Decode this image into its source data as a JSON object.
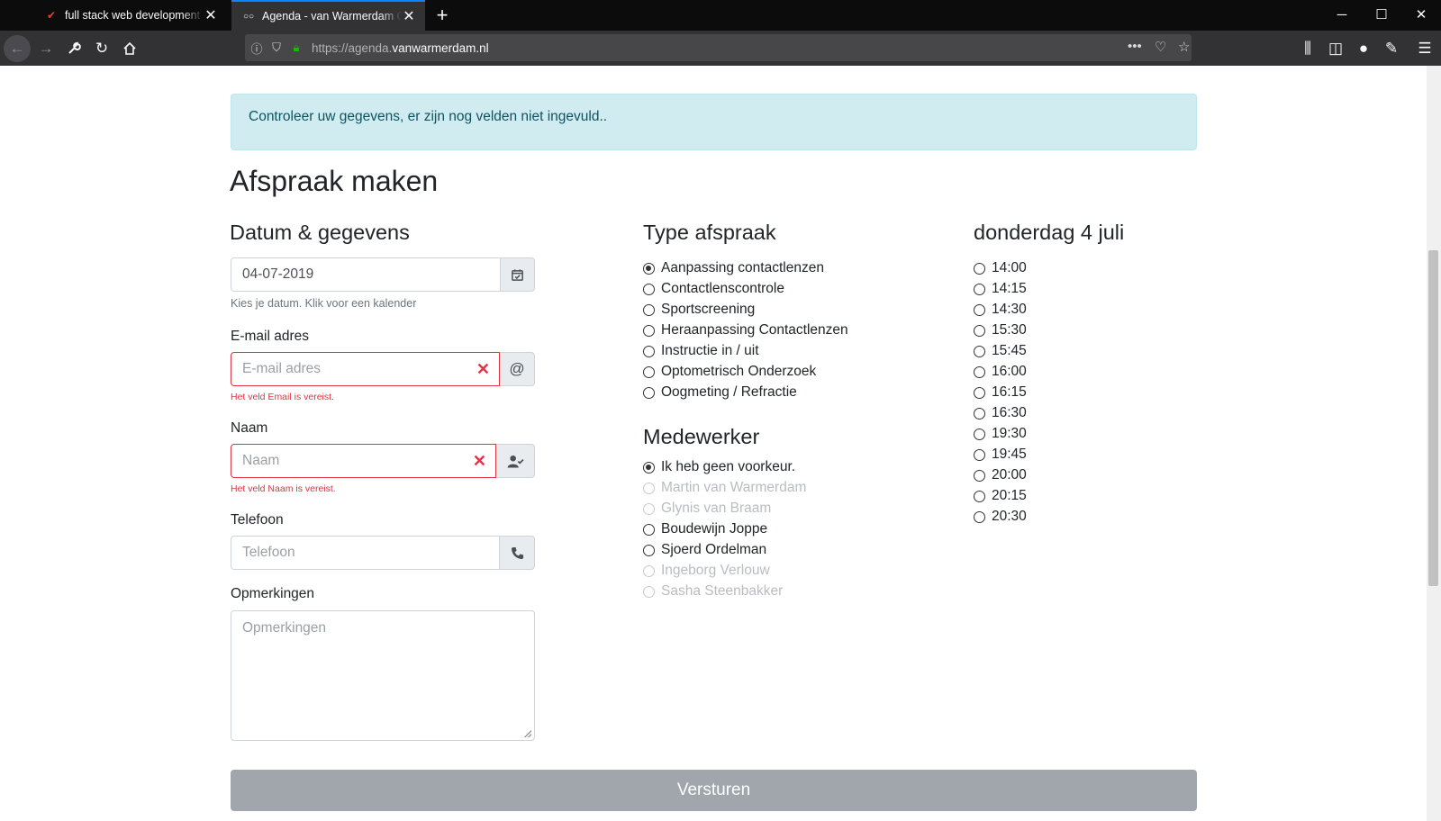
{
  "browser": {
    "tabs": [
      {
        "title": "full stack web development .ne",
        "icon": "brand-bird-icon"
      },
      {
        "title": "Agenda - van Warmerdam Opt",
        "icon": "glasses-icon"
      }
    ],
    "url_prefix": "https://agenda.",
    "url_domain": "vanwarmerdam.nl"
  },
  "alert": {
    "text": "Controleer uw gegevens, er zijn nog velden niet ingevuld.."
  },
  "page": {
    "title": "Afspraak maken"
  },
  "left": {
    "heading": "Datum & gegevens",
    "date": {
      "value": "04-07-2019",
      "help": "Kies je datum. Klik voor een kalender"
    },
    "email": {
      "label": "E-mail adres",
      "placeholder": "E-mail adres",
      "error": "Het veld Email is vereist."
    },
    "name": {
      "label": "Naam",
      "placeholder": "Naam",
      "error": "Het veld Naam is vereist."
    },
    "phone": {
      "label": "Telefoon",
      "placeholder": "Telefoon"
    },
    "remarks": {
      "label": "Opmerkingen",
      "placeholder": "Opmerkingen"
    }
  },
  "type": {
    "heading": "Type afspraak",
    "options": [
      {
        "label": "Aanpassing contactlenzen",
        "checked": true
      },
      {
        "label": "Contactlenscontrole",
        "checked": false
      },
      {
        "label": "Sportscreening",
        "checked": false
      },
      {
        "label": "Heraanpassing Contactlenzen",
        "checked": false
      },
      {
        "label": "Instructie in / uit",
        "checked": false
      },
      {
        "label": "Optometrisch Onderzoek",
        "checked": false
      },
      {
        "label": "Oogmeting / Refractie",
        "checked": false
      }
    ]
  },
  "staff": {
    "heading": "Medewerker",
    "options": [
      {
        "label": "Ik heb geen voorkeur.",
        "checked": true,
        "disabled": false
      },
      {
        "label": "Martin van Warmerdam",
        "checked": false,
        "disabled": true
      },
      {
        "label": "Glynis van Braam",
        "checked": false,
        "disabled": true
      },
      {
        "label": "Boudewijn Joppe",
        "checked": false,
        "disabled": false
      },
      {
        "label": "Sjoerd Ordelman",
        "checked": false,
        "disabled": false
      },
      {
        "label": "Ingeborg Verlouw",
        "checked": false,
        "disabled": true
      },
      {
        "label": "Sasha Steenbakker",
        "checked": false,
        "disabled": true
      }
    ]
  },
  "times": {
    "heading": "donderdag 4 juli",
    "slots": [
      "14:00",
      "14:15",
      "14:30",
      "15:30",
      "15:45",
      "16:00",
      "16:15",
      "16:30",
      "19:30",
      "19:45",
      "20:00",
      "20:15",
      "20:30"
    ]
  },
  "submit": {
    "label": "Versturen"
  }
}
